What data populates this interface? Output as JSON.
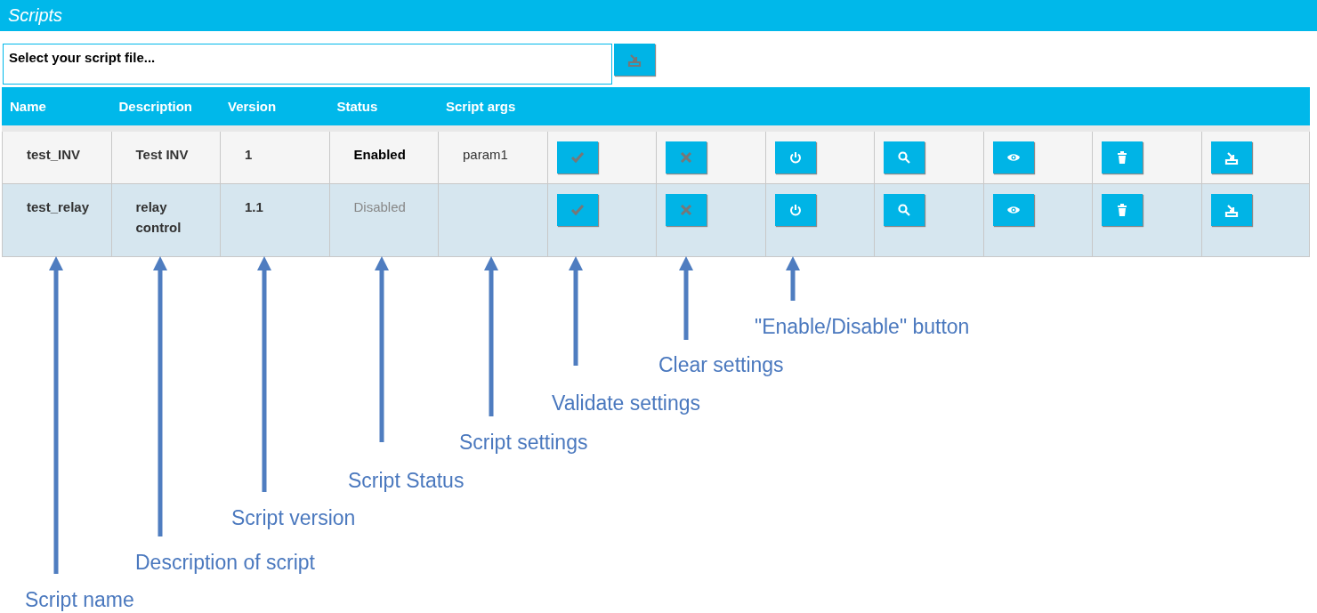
{
  "title": "Scripts",
  "file_picker": {
    "label": "Select your script file...",
    "upload_disabled": true
  },
  "table": {
    "columns": [
      "Name",
      "Description",
      "Version",
      "Status",
      "Script args"
    ],
    "rows": [
      {
        "name": "test_INV",
        "description": "Test INV",
        "version": "1",
        "status": "Enabled",
        "enabled": true,
        "args": "param1",
        "actions": [
          {
            "kind": "validate",
            "disabled": true
          },
          {
            "kind": "clear",
            "disabled": true
          },
          {
            "kind": "power",
            "disabled": false
          },
          {
            "kind": "search",
            "disabled": false
          },
          {
            "kind": "view",
            "disabled": false
          },
          {
            "kind": "delete",
            "disabled": false
          },
          {
            "kind": "export",
            "disabled": false
          }
        ]
      },
      {
        "name": "test_relay",
        "description": "relay control",
        "version": "1.1",
        "status": "Disabled",
        "enabled": false,
        "actions": [
          {
            "kind": "validate",
            "disabled": true
          },
          {
            "kind": "clear",
            "disabled": true
          },
          {
            "kind": "power",
            "disabled": false
          },
          {
            "kind": "search",
            "disabled": false
          },
          {
            "kind": "view",
            "disabled": false
          },
          {
            "kind": "delete",
            "disabled": false
          },
          {
            "kind": "export",
            "disabled": false
          }
        ]
      }
    ]
  },
  "annotations": [
    {
      "text": "\"Enable/Disable\" button"
    },
    {
      "text": "Clear settings"
    },
    {
      "text": "Validate settings"
    },
    {
      "text": "Script settings"
    },
    {
      "text": "Script Status"
    },
    {
      "text": "Script version"
    },
    {
      "text": "Description of script"
    },
    {
      "text": "Script name"
    }
  ]
}
